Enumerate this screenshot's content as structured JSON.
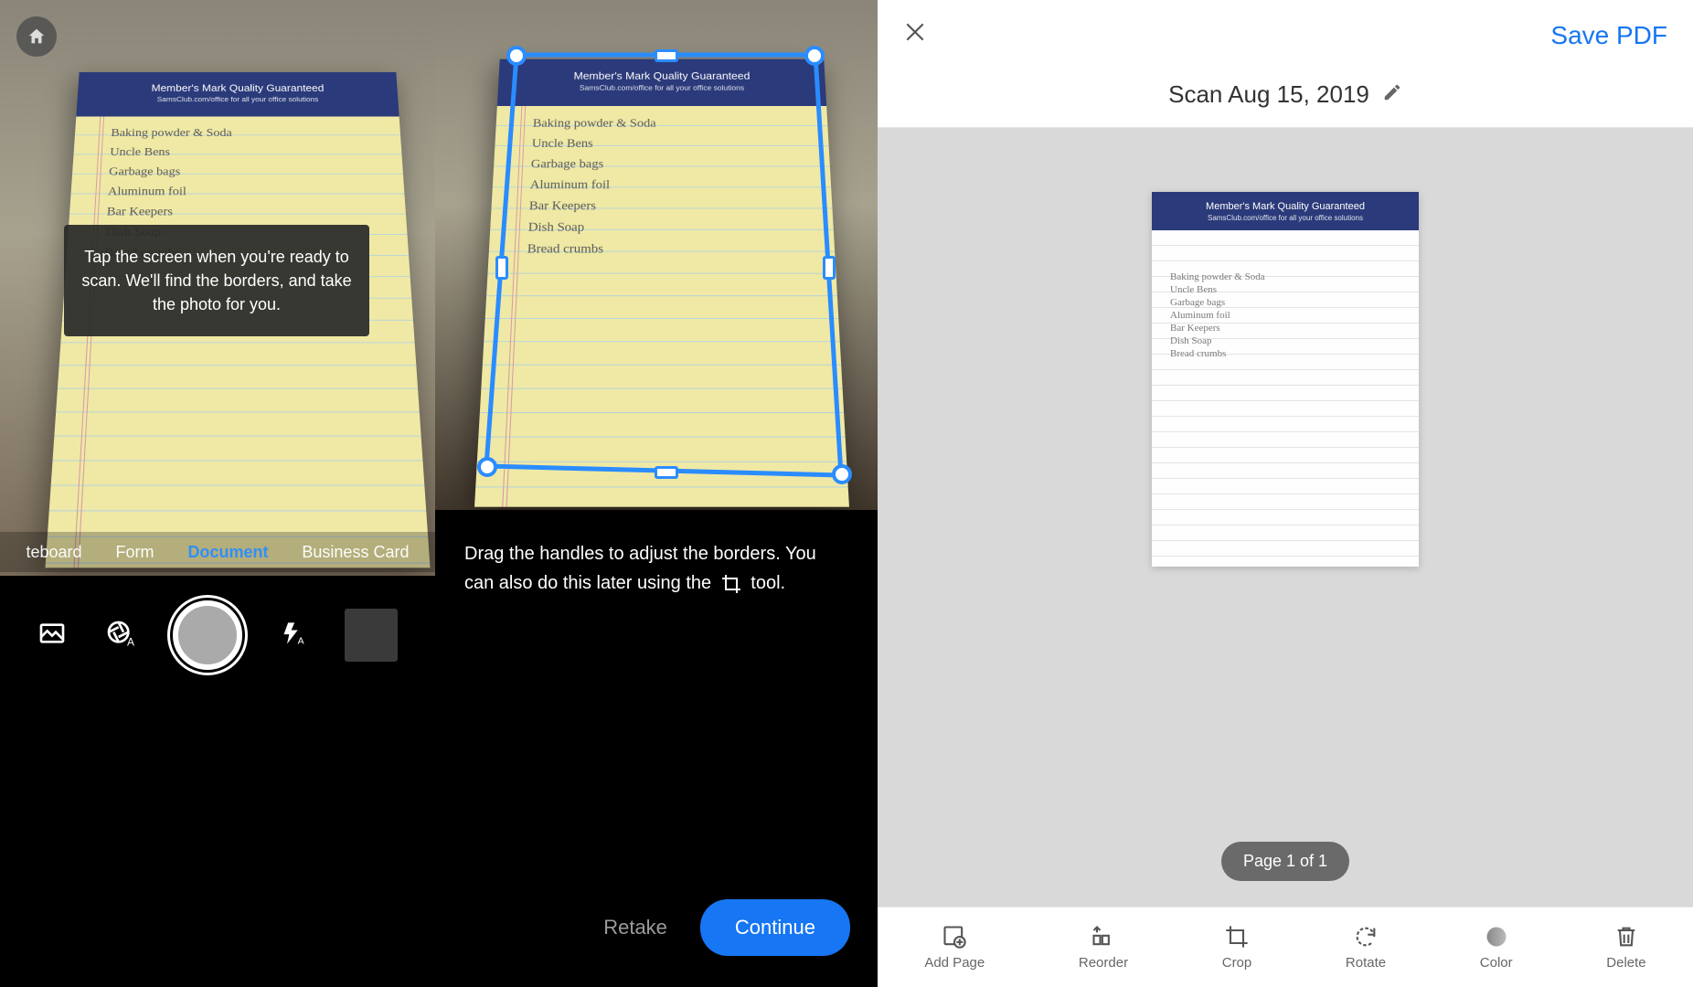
{
  "notepad": {
    "header": "Member's Mark Quality Guaranteed",
    "subheader": "SamsClub.com/office for all your office solutions",
    "lines": [
      "Baking powder & Soda",
      "Uncle Bens",
      "Garbage bags",
      "Aluminum foil",
      "Bar Keepers",
      "Dish Soap",
      "Bread crumbs"
    ]
  },
  "pane1": {
    "tooltip": "Tap the screen when you're ready to scan. We'll find the borders, and take the photo for you.",
    "modes": {
      "whiteboard": "teboard",
      "form": "Form",
      "document": "Document",
      "businesscard": "Business Card"
    }
  },
  "pane2": {
    "hint_pre": "Drag the handles to adjust the borders. You can also do this later using the ",
    "hint_post": " tool.",
    "retake": "Retake",
    "continue": "Continue"
  },
  "pane3": {
    "save": "Save PDF",
    "title": "Scan Aug 15, 2019",
    "page_indicator": "Page 1 of 1",
    "tools": {
      "addpage": "Add Page",
      "reorder": "Reorder",
      "crop": "Crop",
      "rotate": "Rotate",
      "color": "Color",
      "delete": "Delete"
    }
  }
}
